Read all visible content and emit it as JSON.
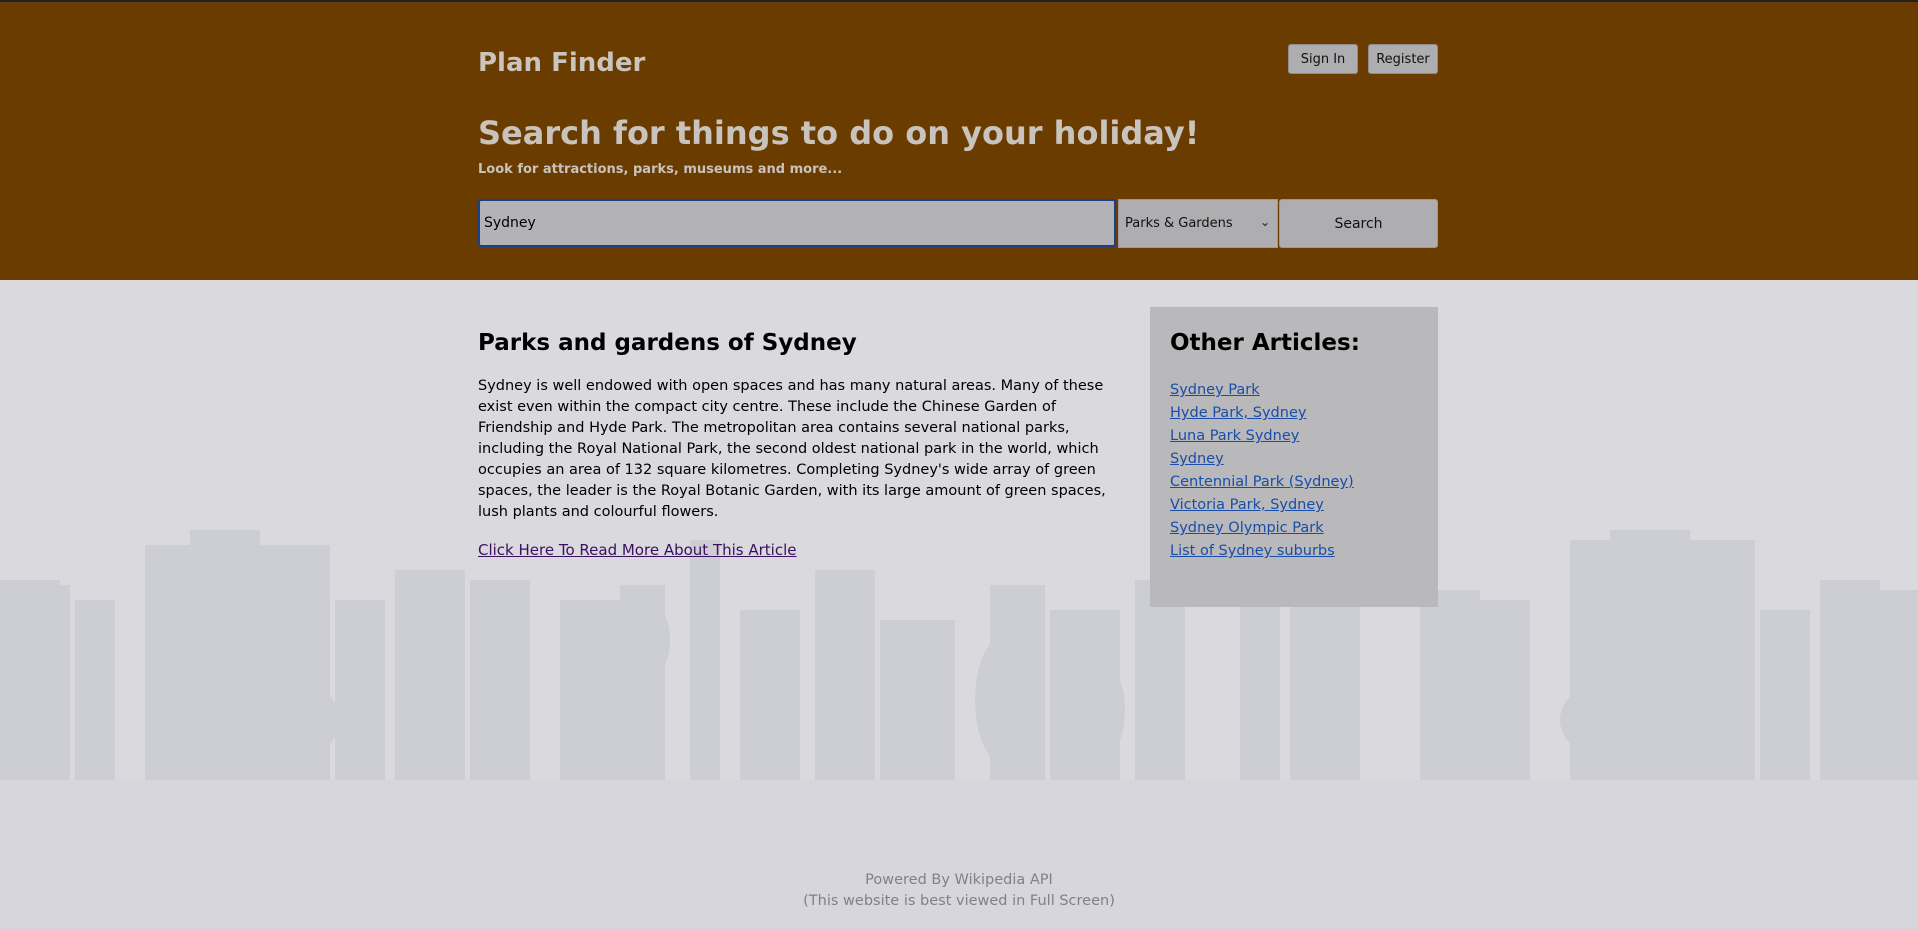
{
  "header": {
    "brand": "Plan Finder",
    "signin_label": "Sign In",
    "register_label": "Register",
    "title": "Search for things to do on your holiday!",
    "subtitle": "Look for attractions, parks, museums and more...",
    "search_value": "Sydney",
    "category_selected": "Parks & Gardens",
    "search_button_label": "Search"
  },
  "article": {
    "heading": "Parks and gardens of Sydney",
    "body": "Sydney is well endowed with open spaces and has many natural areas. Many of these exist even within the compact city centre. These include the Chinese Garden of Friendship and Hyde Park. The metropolitan area contains several national parks, including the Royal National Park, the second oldest national park in the world, which occupies an area of 132 square kilometres. Completing Sydney's wide array of green spaces, the leader is the Royal Botanic Garden, with its large amount of green spaces, lush plants and colourful flowers.",
    "read_more": "Click Here To Read More About This Article"
  },
  "sidebar": {
    "heading": "Other Articles:",
    "links": [
      "Sydney Park",
      "Hyde Park, Sydney",
      "Luna Park Sydney",
      "Sydney",
      "Centennial Park (Sydney)",
      "Victoria Park, Sydney",
      "Sydney Olympic Park",
      "List of Sydney suburbs"
    ]
  },
  "footer": {
    "line1": "Powered By Wikipedia API",
    "line2": "(This website is best viewed in Full Screen)"
  },
  "colors": {
    "header_bg": "#6b3c00",
    "page_bg": "#d9d9de",
    "link": "#1a4da8",
    "visited_link": "#3b1060"
  }
}
